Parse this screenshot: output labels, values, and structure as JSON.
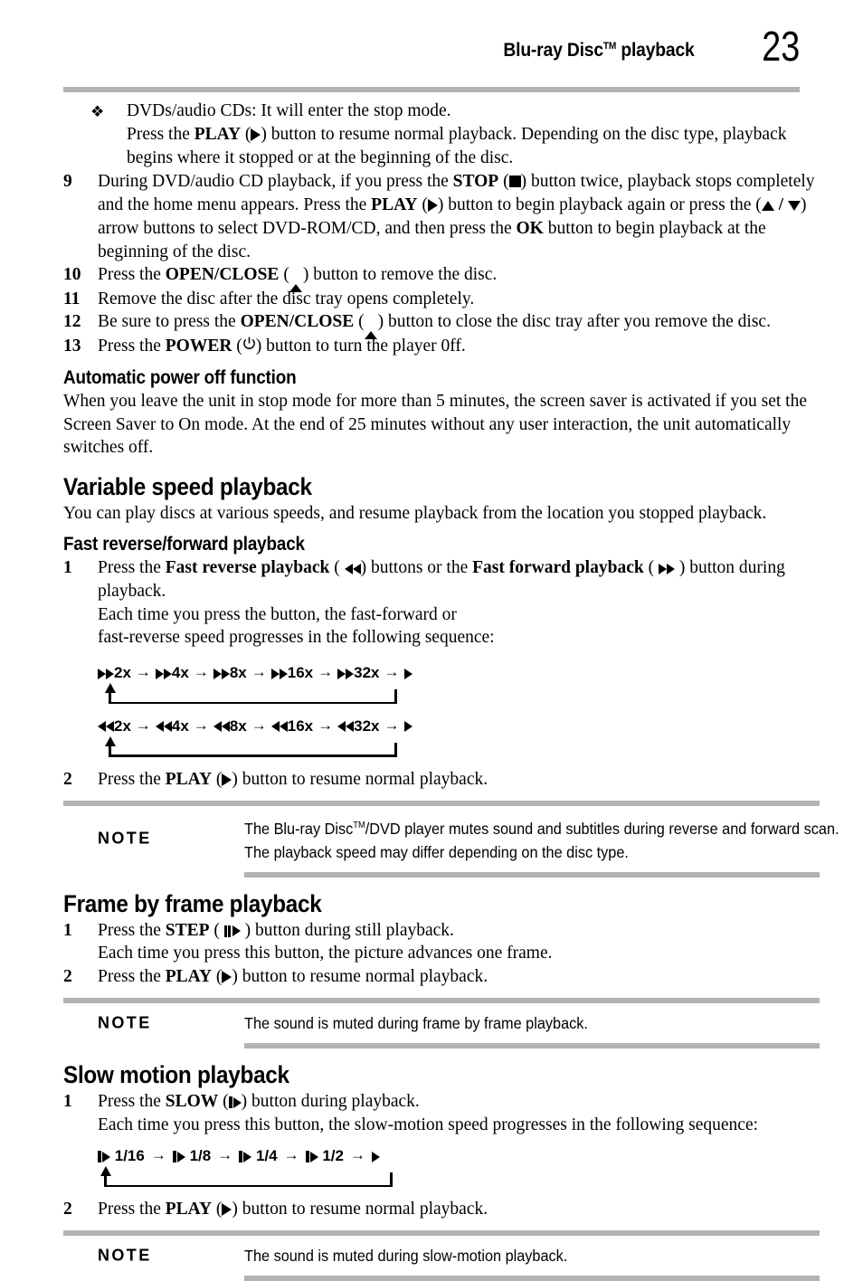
{
  "header": {
    "title_main": "Blu-ray Disc",
    "title_tm": "TM",
    "title_rest": " playback",
    "page_number": "23"
  },
  "bullet_item": {
    "line1": "DVDs/audio CDs: It will enter the stop mode.",
    "line2_pre": "Press the ",
    "line2_bold": "PLAY",
    "line2_post": ") button to resume normal playback. Depending on the disc type, playback begins where it stopped or at the beginning of the disc."
  },
  "steps": [
    {
      "number": "9",
      "seg1": "During DVD/audio CD playback, if you press the ",
      "bold1": "STOP",
      "seg2": ") button twice, playback stops completely and the home menu appears. Press the ",
      "bold2": "PLAY",
      "seg3": ") button to begin playback again or press the (",
      "seg4": ") arrow buttons to select DVD-ROM/CD, and then press the ",
      "bold3": "OK",
      "seg5": " button to begin playback at the beginning of the disc."
    },
    {
      "number": "10",
      "seg1": "Press the ",
      "bold1": "OPEN/CLOSE",
      "seg2": ") button to remove the disc."
    },
    {
      "number": "11",
      "seg1": "Remove the disc after the disc tray opens completely."
    },
    {
      "number": "12",
      "seg1": "Be sure to press the ",
      "bold1": "OPEN/CLOSE",
      "seg2": ") button to close the disc tray after you remove the disc."
    },
    {
      "number": "13",
      "seg1": "Press the ",
      "bold1": "POWER",
      "seg2": ") button to turn the player 0ff."
    }
  ],
  "auto_power_off": {
    "heading": "Automatic power off function",
    "body": "When you leave the unit in stop mode for more than 5 minutes, the screen saver is activated if you set the Screen Saver to On mode. At the end of 25 minutes without any user interaction, the unit automatically switches off."
  },
  "variable_speed": {
    "heading": "Variable speed playback",
    "body": "You can play discs at various speeds, and resume playback from the location you stopped playback."
  },
  "fast_section": {
    "heading": "Fast reverse/forward playback",
    "step1_number": "1",
    "step1_seg1": "Press the ",
    "step1_bold1": "Fast reverse playback",
    "step1_seg2": ") buttons or the ",
    "step1_bold2": "Fast forward playback",
    "step1_seg3": ") button during playback.",
    "step1_line2": "Each time you press the button, the fast-forward or",
    "step1_line3": "fast-reverse speed progresses in the following sequence:",
    "step2_number": "2",
    "step2_seg1": "Press the ",
    "step2_bold1": "PLAY",
    "step2_seg2": ") button to resume normal playback."
  },
  "forward_sequence": {
    "speeds": [
      "2x",
      "4x",
      "8x",
      "16x",
      "32x"
    ],
    "arrow": "→",
    "end_label": "play"
  },
  "reverse_sequence": {
    "speeds": [
      "2x",
      "4x",
      "8x",
      "16x",
      "32x"
    ],
    "arrow": "→",
    "end_label": "play"
  },
  "slow_sequence": {
    "speeds": [
      "1/16",
      "1/8",
      "1/4",
      "1/2"
    ],
    "arrow": "→",
    "end_label": "play"
  },
  "notes": [
    {
      "label": "NOTE",
      "line1_pre": "The Blu-ray Disc",
      "line1_tm": "TM",
      "line1_post": "/DVD player mutes sound and subtitles during reverse and forward scan.",
      "line2": "The playback speed may differ depending on the disc type."
    },
    {
      "label": "NOTE",
      "line1_pre": "The sound is muted during frame by frame playback.",
      "line1_tm": "",
      "line1_post": "",
      "line2": ""
    },
    {
      "label": "NOTE",
      "line1_pre": "The sound is muted during slow-motion playback.",
      "line1_tm": "",
      "line1_post": "",
      "line2": ""
    }
  ],
  "frame_section": {
    "heading": "Frame by frame playback",
    "step1_number": "1",
    "step1_seg1": "Press the ",
    "step1_bold1": "STEP",
    "step1_seg2": ") button during still playback.",
    "step1_line2": "Each time you press this button, the picture advances one frame.",
    "step2_number": "2",
    "step2_seg1": "Press the ",
    "step2_bold1": "PLAY",
    "step2_seg2": ") button to resume normal playback."
  },
  "slow_section": {
    "heading": "Slow motion playback",
    "step1_number": "1",
    "step1_seg1": "Press the ",
    "step1_bold1": "SLOW",
    "step1_seg2": ") button during playback.",
    "step1_line2": "Each time you press this button, the slow-motion speed progresses in the following sequence:",
    "step2_number": "2",
    "step2_seg1": "Press the ",
    "step2_bold1": "PLAY",
    "step2_seg2": ") button to resume normal playback."
  },
  "colors": {
    "rule_gray": "#b3b3b3",
    "text_black": "#000000",
    "page_bg": "#ffffff"
  }
}
